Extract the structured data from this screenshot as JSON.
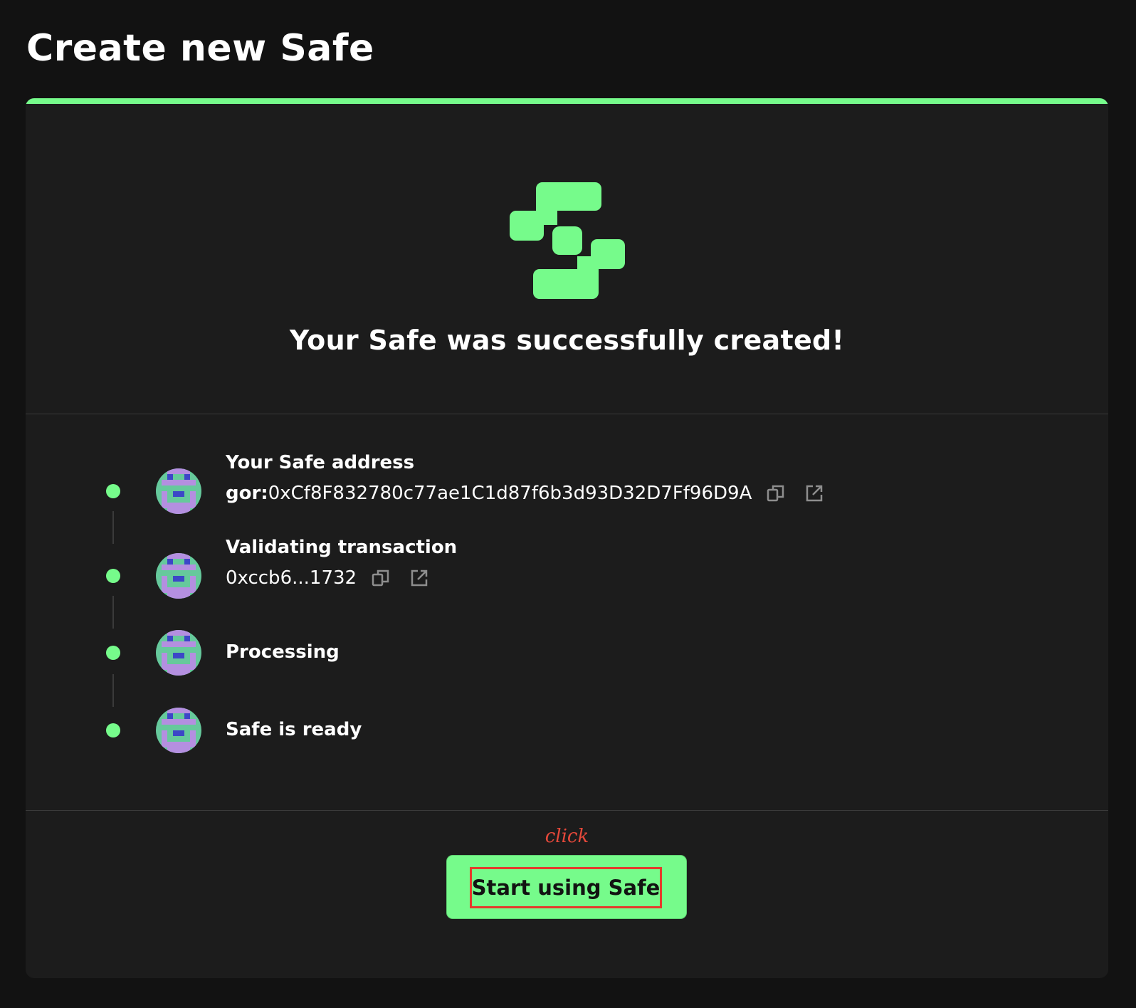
{
  "page": {
    "title": "Create new Safe"
  },
  "progress": {
    "fraction": 1.0,
    "color": "#76fb8b"
  },
  "success": {
    "logo_icon": "safe-logo-icon",
    "title": "Your Safe was successfully created!"
  },
  "steps": [
    {
      "label": "Your Safe address",
      "sub_prefix": "gor:",
      "sub_value": "0xCf8F832780c77ae1C1d87f6b3d93D32D7Ff96D9A",
      "icons": [
        "copy-icon",
        "external-link-icon"
      ]
    },
    {
      "label": "Validating transaction",
      "sub_prefix": "",
      "sub_value": "0xccb6...1732",
      "icons": [
        "copy-icon",
        "external-link-icon"
      ]
    },
    {
      "label": "Processing"
    },
    {
      "label": "Safe is ready"
    }
  ],
  "annotation": {
    "click_note": "click",
    "color": "#e5483a"
  },
  "footer": {
    "start_button_label": "Start using Safe"
  },
  "colors": {
    "accent": "#76fb8b",
    "background": "#121212",
    "card": "#1c1c1c",
    "highlight_box": "#e53b2b"
  }
}
